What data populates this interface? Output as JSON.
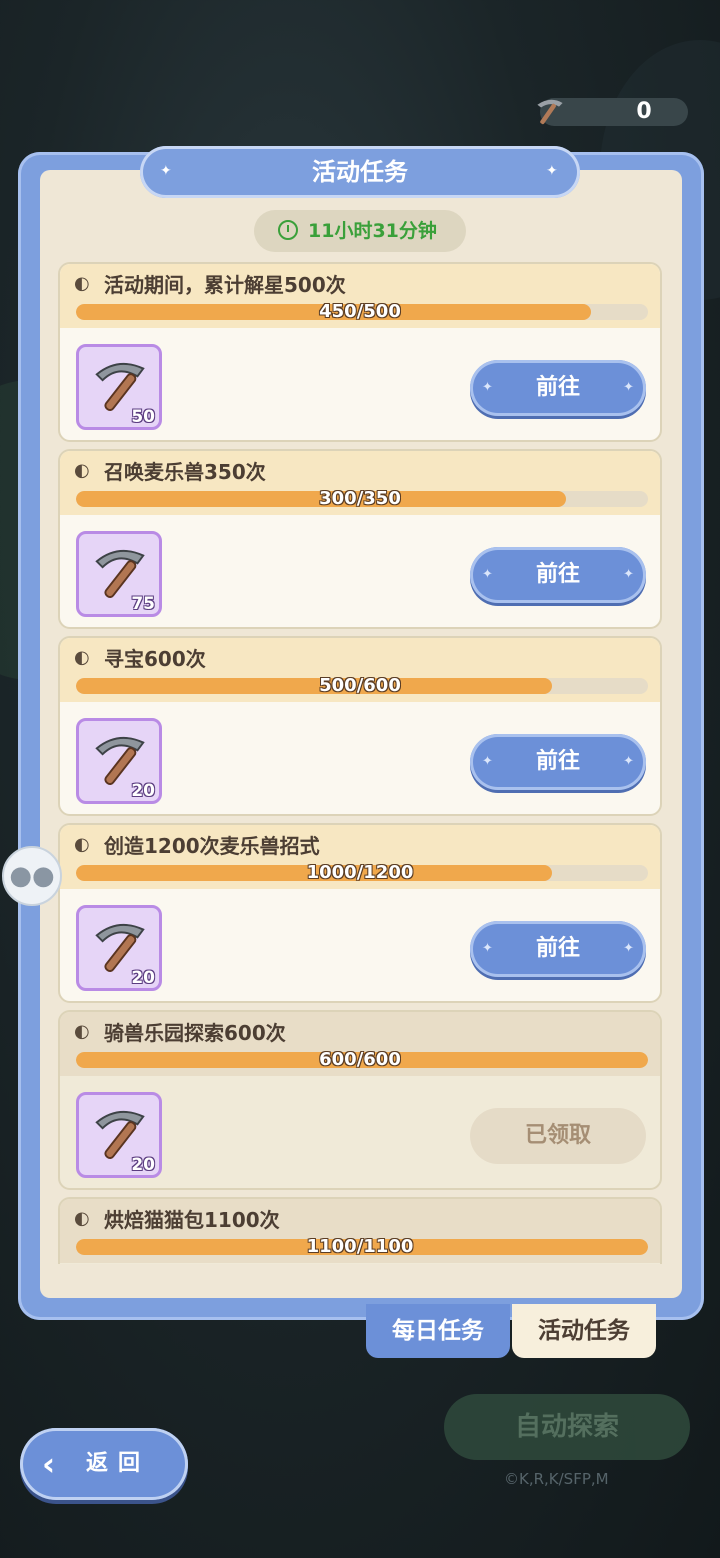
{
  "counter": {
    "value": "0",
    "icon": "pickaxe-icon"
  },
  "title": "活动任务",
  "timer": "11小时31分钟",
  "tasks": [
    {
      "name": "活动期间，累计解星500次",
      "progress_text": "450/500",
      "progress": 0.9,
      "reward_qty": "50",
      "button": "前往",
      "claimed": false
    },
    {
      "name": "召唤麦乐兽350次",
      "progress_text": "300/350",
      "progress": 0.857,
      "reward_qty": "75",
      "button": "前往",
      "claimed": false
    },
    {
      "name": "寻宝600次",
      "progress_text": "500/600",
      "progress": 0.833,
      "reward_qty": "20",
      "button": "前往",
      "claimed": false
    },
    {
      "name": "创造1200次麦乐兽招式",
      "progress_text": "1000/1200",
      "progress": 0.833,
      "reward_qty": "20",
      "button": "前往",
      "claimed": false
    },
    {
      "name": "骑兽乐园探索600次",
      "progress_text": "600/600",
      "progress": 1.0,
      "reward_qty": "20",
      "button": "已领取",
      "claimed": true
    },
    {
      "name": "烘焙猫猫包1100次",
      "progress_text": "1100/1100",
      "progress": 1.0,
      "reward_qty": "",
      "button": "",
      "claimed": true
    }
  ],
  "tabs": {
    "daily": "每日任务",
    "event": "活动任务"
  },
  "back_label": "返回",
  "auto_explore": "自动探索",
  "copyright": "©K,R,K/SFP,M",
  "colors": {
    "panel": "#7d9fde",
    "progress": "#f0a84c",
    "timer_text": "#3aa03a"
  }
}
